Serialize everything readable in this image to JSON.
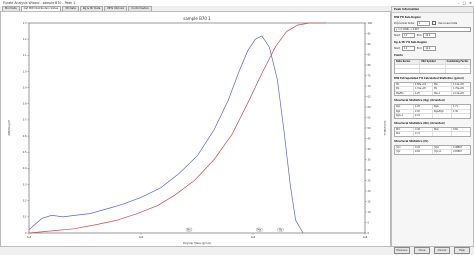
{
  "window": {
    "title": "Purate Analysis Wizard - sample B70 - Peak 1"
  },
  "tabs": [
    "Mol Data",
    "Def MW Distribution Slides",
    "3D Data",
    "Rg & Mr Data",
    "MHS Intrinsic",
    "Conformation"
  ],
  "chart": {
    "title": "sample B70 1",
    "xlabel": "Polymer Mass (g/mol)",
    "ylabel_left": "dWf/dLog M",
    "ylabel_right": "Cumulative",
    "markers": [
      "Mn",
      "Mw",
      "Mz"
    ]
  },
  "chart_data": {
    "type": "line",
    "title": "sample B70 1",
    "xlabel": "Polymer Mass (g/mol)",
    "ylabel": "dWf/dLog M",
    "x_scale": "log",
    "xlim": [
      1000,
      1000000
    ],
    "ylim": [
      0,
      1.3
    ],
    "y2lim": [
      0,
      100
    ],
    "x_ticks": [
      "1e3",
      "1e4",
      "1e5",
      "1e6"
    ],
    "y_ticks": [
      "0",
      "0.1",
      "0.2",
      "0.3",
      "0.4",
      "0.5",
      "0.6",
      "0.7",
      "0.8",
      "0.9",
      "1.0",
      "1.1",
      "1.2",
      "1.3"
    ],
    "y2_ticks": [
      "0",
      "5",
      "10",
      "15",
      "20",
      "25",
      "30",
      "35",
      "40",
      "45",
      "50",
      "55",
      "60",
      "65",
      "70",
      "75",
      "80",
      "85",
      "90",
      "95",
      "100"
    ],
    "series": [
      {
        "name": "differential",
        "color": "#5a63d8",
        "axis": "left",
        "x": [
          1000,
          1300,
          1600,
          2000,
          2600,
          3500,
          5000,
          7000,
          10000,
          15000,
          22000,
          32000,
          45000,
          60000,
          75000,
          90000,
          105000,
          120000,
          140000,
          165000,
          190000,
          215000,
          240000,
          280000
        ],
        "y": [
          0.02,
          0.09,
          0.11,
          0.1,
          0.11,
          0.12,
          0.15,
          0.18,
          0.22,
          0.28,
          0.37,
          0.48,
          0.64,
          0.82,
          1.0,
          1.13,
          1.2,
          1.22,
          1.15,
          0.95,
          0.62,
          0.3,
          0.08,
          0.0
        ]
      },
      {
        "name": "cumulative",
        "color": "#c84a4a",
        "axis": "right",
        "x": [
          1000,
          1600,
          2500,
          4000,
          6000,
          9000,
          14000,
          20000,
          30000,
          45000,
          65000,
          90000,
          120000,
          160000,
          200000,
          250000,
          320000,
          450000
        ],
        "y": [
          0,
          1,
          2,
          4,
          6,
          9,
          13,
          18,
          25,
          35,
          47,
          62,
          76,
          89,
          96,
          99,
          100,
          100
        ]
      }
    ]
  },
  "sidebar": {
    "header": "Peak Information",
    "mw_section": "MW Fit Sub-Region",
    "polynomial_label": "Polynomial Order",
    "polynomial_value": "1",
    "use_label": "Use Linear Data",
    "fit_label": "y = 0.1096x + 0.067",
    "start_label": "Start",
    "start_value": "1.0",
    "end_label": "End",
    "end_value": "12.0",
    "rg_section": "Rg & Mr Fit Sub-Region",
    "rg_start": "1.0",
    "rg_end": "12.0",
    "points_section": "Points",
    "points_headers": [
      "Data Series",
      "Mid Symbol",
      "Combining Factor"
    ],
    "mw_stats_section": "MW Extrapolated Fit Calculated Statistics (g/mol)",
    "mw_stats": [
      [
        "Mn",
        "2.68e+04",
        "Mw",
        "1.14e+05"
      ],
      [
        "Mp",
        "1.31e+05",
        "Mz",
        "1.76e+05"
      ],
      [
        "Mw/Mn",
        "4.25",
        "Mz+1",
        "2.12e+05"
      ]
    ],
    "rg_stats_section": "Structural Statistics (Rg) (Oriented)",
    "rg_stats": [
      [
        "Rgn",
        "1.26",
        "Rgw",
        "1.71"
      ],
      [
        "Rgz",
        "2.02",
        "Rgw/Rgn",
        "1.36"
      ],
      [
        "Rgz+1",
        "2.24",
        "",
        ""
      ]
    ],
    "rh_stats_section": "Structural Statistics (Rh) (Oriented)",
    "rh_stats": [
      [
        "Rhn",
        "0.46",
        "Rhw",
        "0.60"
      ],
      [
        "Rhz",
        "0.71",
        "",
        ""
      ]
    ],
    "iv_stats_section": "Structural Statistics (IV)",
    "iv_stats": [
      [
        "[n]n",
        "0.43",
        "[n]w",
        "0.48897"
      ],
      [
        "[n]z",
        "0.62",
        "[n]z+1",
        "0.65867"
      ]
    ]
  },
  "footer": {
    "status": "",
    "buttons": [
      "Previous",
      "Done",
      "Cancel",
      "Help"
    ]
  }
}
